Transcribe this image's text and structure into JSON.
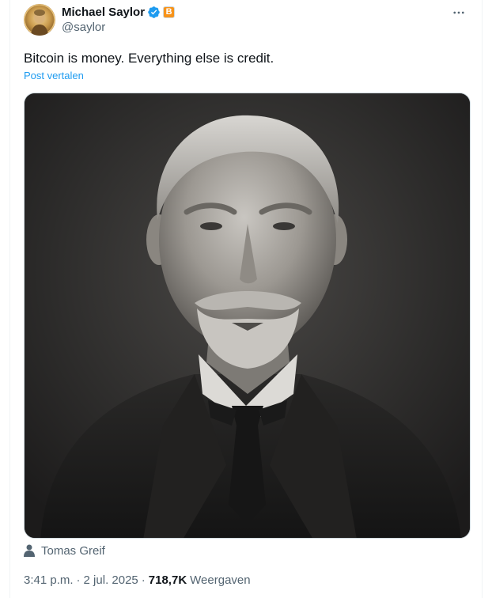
{
  "author": {
    "display_name": "Michael Saylor",
    "handle": "@saylor",
    "verified_icon": "verified-badge-icon",
    "affiliate_badge": "B",
    "accent_color": "#1d9bf0",
    "badge_color": "#f7931a"
  },
  "tweet": {
    "text": "Bitcoin is money. Everything else is credit.",
    "translate_label": "Post vertalen"
  },
  "media": {
    "tag_name": "Tomas Greif"
  },
  "meta": {
    "time": "3:41 p.m.",
    "separator": "·",
    "date": "2 jul. 2025",
    "views_count": "718,7K",
    "views_label": "Weergaven"
  }
}
